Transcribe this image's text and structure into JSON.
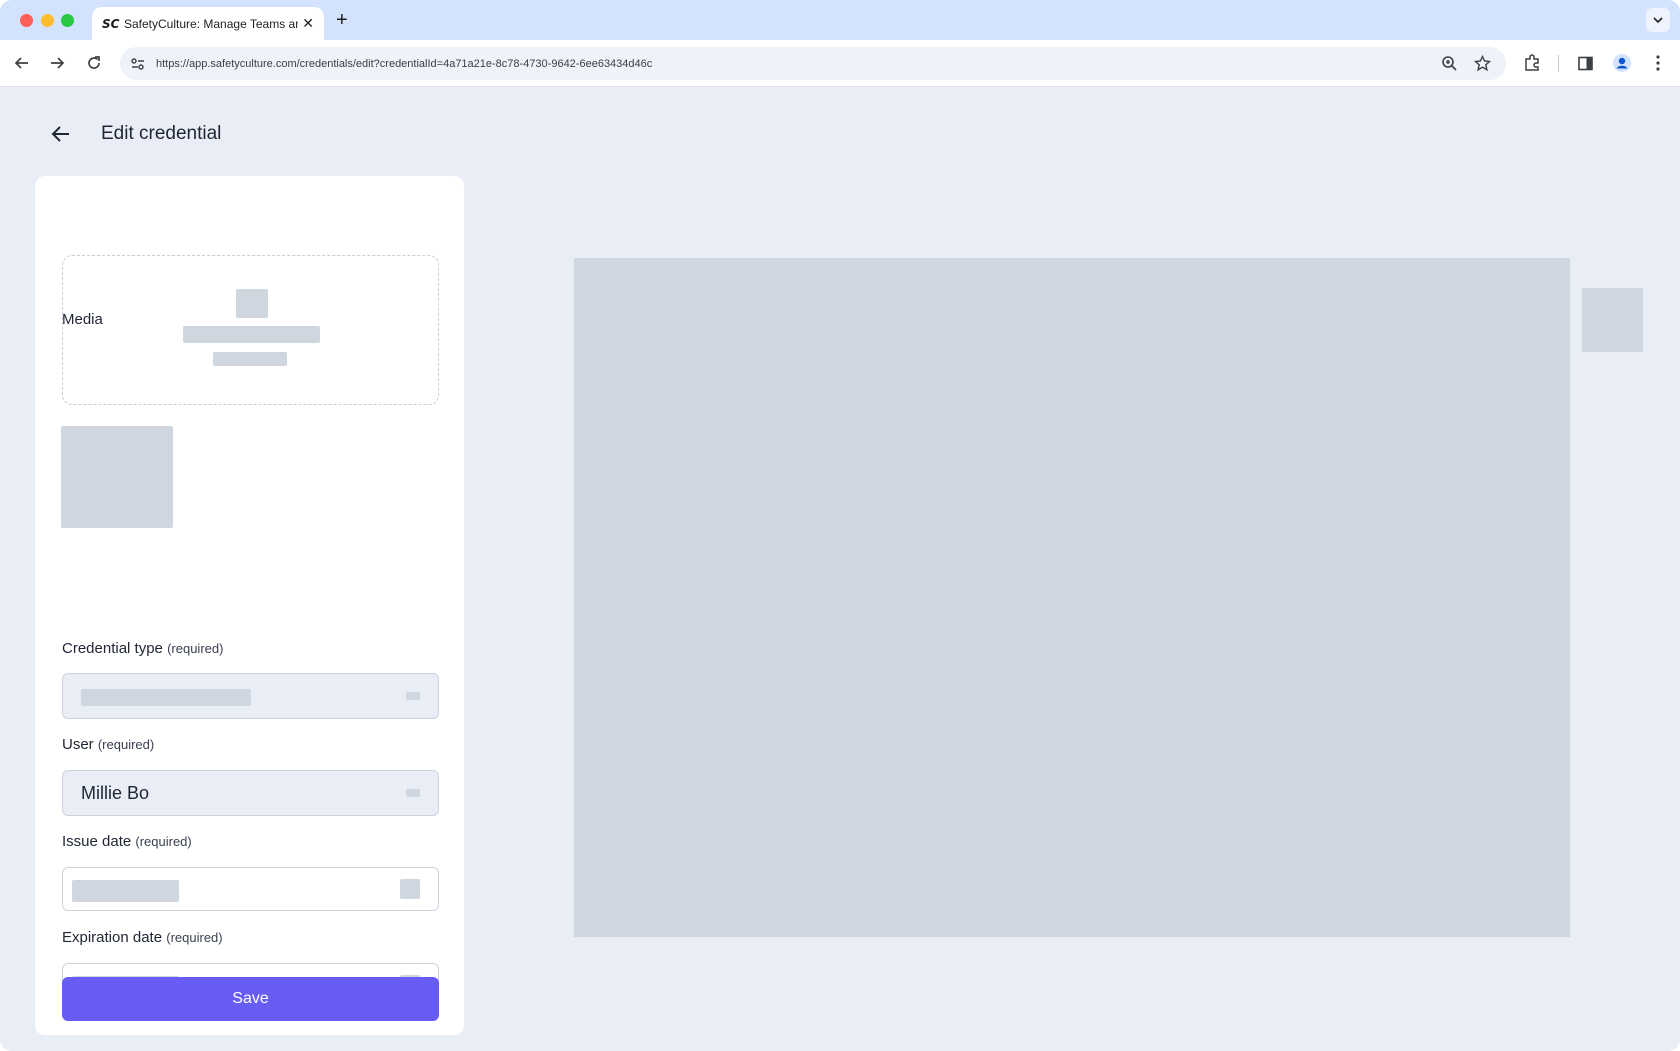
{
  "browser": {
    "tab": {
      "favicon": "SC",
      "title": "SafetyCulture: Manage Teams and..."
    },
    "url": "https://app.safetyculture.com/credentials/edit?credentialId=4a71a21e-8c78-4730-9642-6ee63434d46c",
    "icons": [
      "back-arrow-icon",
      "forward-arrow-icon",
      "reload-icon",
      "site-settings-icon",
      "zoom-icon",
      "star-icon",
      "extensions-icon",
      "side-panel-icon",
      "profile-icon",
      "kebab-menu-icon"
    ]
  },
  "page": {
    "title": "Edit credential"
  },
  "form": {
    "media_label": "Media",
    "credential_type": {
      "label": "Credential type",
      "required": "(required)"
    },
    "user": {
      "label": "User",
      "required": "(required)",
      "value": "Millie Bo"
    },
    "issue_date": {
      "label": "Issue date",
      "required": "(required)"
    },
    "expiration_date": {
      "label": "Expiration date",
      "required": "(required)"
    },
    "save_label": "Save"
  },
  "colors": {
    "accent": "#675df4",
    "page_bg": "#e9edf6",
    "skeleton": "#d0d6e0"
  }
}
